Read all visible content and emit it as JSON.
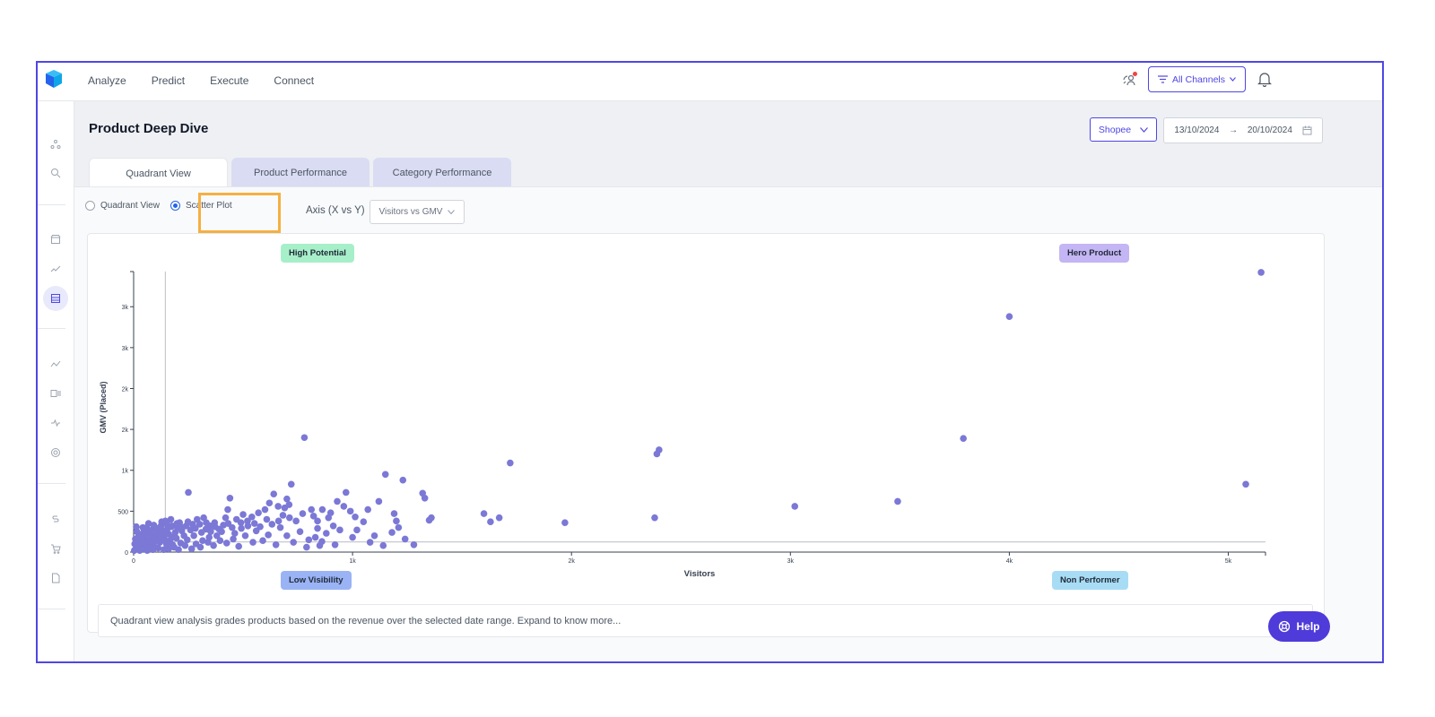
{
  "nav": {
    "items": [
      "Analyze",
      "Predict",
      "Execute",
      "Connect"
    ]
  },
  "topbar": {
    "channels_label": "All Channels"
  },
  "page": {
    "title": "Product Deep Dive",
    "marketplace": "Shopee",
    "date_from": "13/10/2024",
    "date_arrow": "→",
    "date_to": "20/10/2024"
  },
  "tabs": [
    "Quadrant View",
    "Product Performance",
    "Category Performance"
  ],
  "controls": {
    "radio_quadrant": "Quadrant View",
    "radio_scatter": "Scatter Plot",
    "axis_label": "Axis (X vs Y)",
    "axis_value": "Visitors vs GMV"
  },
  "quadrants": {
    "top_left": "High Potential",
    "top_right": "Hero Product",
    "bottom_left": "Low Visibility",
    "bottom_right": "Non Performer"
  },
  "footer": {
    "note": "Quadrant view analysis grades products based on the revenue over the selected date range. Expand to know more..."
  },
  "help": {
    "label": "Help"
  },
  "colors": {
    "accent": "#4f46e5",
    "point": "#7b78d6",
    "high_potential": "#a7efc9",
    "hero_product": "#c4b5f4",
    "low_visibility": "#9ab3f5",
    "non_performer": "#a8dcf5"
  },
  "chart_data": {
    "type": "scatter",
    "xlabel": "Visitors",
    "ylabel": "GMV (Placed)",
    "x_ticks": [
      {
        "v": 0,
        "label": "0"
      },
      {
        "v": 1000,
        "label": "1k"
      },
      {
        "v": 2000,
        "label": "2k"
      },
      {
        "v": 3000,
        "label": "3k"
      },
      {
        "v": 4000,
        "label": "4k"
      },
      {
        "v": 5000,
        "label": "5k"
      }
    ],
    "y_ticks": [
      {
        "v": 0,
        "label": "0"
      },
      {
        "v": 500,
        "label": "500"
      },
      {
        "v": 1000,
        "label": "1k"
      },
      {
        "v": 1500,
        "label": "2k"
      },
      {
        "v": 2000,
        "label": "2k"
      },
      {
        "v": 2500,
        "label": "3k"
      },
      {
        "v": 3000,
        "label": "3k"
      }
    ],
    "xlim": [
      0,
      5170
    ],
    "ylim": [
      0,
      3430
    ],
    "threshold_x": 145,
    "threshold_y": 125,
    "points": [
      [
        5150,
        3420
      ],
      [
        4000,
        2880
      ],
      [
        3790,
        1390
      ],
      [
        5080,
        830
      ],
      [
        3490,
        620
      ],
      [
        3020,
        560
      ],
      [
        2400,
        1250
      ],
      [
        2390,
        1200
      ],
      [
        2380,
        420
      ],
      [
        1720,
        1090
      ],
      [
        1970,
        360
      ],
      [
        1600,
        470
      ],
      [
        1630,
        370
      ],
      [
        1670,
        420
      ],
      [
        780,
        1400
      ],
      [
        1150,
        950
      ],
      [
        1230,
        880
      ],
      [
        1320,
        720
      ],
      [
        1330,
        660
      ],
      [
        1360,
        420
      ],
      [
        1350,
        390
      ],
      [
        1190,
        470
      ],
      [
        1200,
        380
      ],
      [
        1210,
        300
      ],
      [
        1120,
        620
      ],
      [
        1070,
        520
      ],
      [
        1050,
        370
      ],
      [
        970,
        730
      ],
      [
        990,
        500
      ],
      [
        930,
        620
      ],
      [
        960,
        560
      ],
      [
        900,
        480
      ],
      [
        890,
        420
      ],
      [
        840,
        380
      ],
      [
        840,
        290
      ],
      [
        830,
        180
      ],
      [
        850,
        80
      ],
      [
        720,
        830
      ],
      [
        640,
        710
      ],
      [
        700,
        650
      ],
      [
        710,
        580
      ],
      [
        690,
        540
      ],
      [
        660,
        560
      ],
      [
        620,
        600
      ],
      [
        600,
        520
      ],
      [
        570,
        480
      ],
      [
        540,
        430
      ],
      [
        520,
        380
      ],
      [
        500,
        460
      ],
      [
        490,
        360
      ],
      [
        470,
        400
      ],
      [
        440,
        660
      ],
      [
        430,
        520
      ],
      [
        420,
        420
      ],
      [
        450,
        300
      ],
      [
        410,
        330
      ],
      [
        390,
        280
      ],
      [
        370,
        360
      ],
      [
        350,
        320
      ],
      [
        330,
        280
      ],
      [
        320,
        420
      ],
      [
        310,
        240
      ],
      [
        290,
        400
      ],
      [
        270,
        340
      ],
      [
        250,
        730
      ],
      [
        260,
        270
      ],
      [
        240,
        320
      ],
      [
        230,
        200
      ],
      [
        220,
        260
      ],
      [
        210,
        360
      ],
      [
        200,
        300
      ],
      [
        190,
        240
      ],
      [
        180,
        180
      ],
      [
        175,
        320
      ],
      [
        170,
        400
      ],
      [
        165,
        140
      ],
      [
        160,
        220
      ],
      [
        155,
        290
      ],
      [
        150,
        100
      ],
      [
        145,
        380
      ],
      [
        140,
        200
      ],
      [
        135,
        260
      ],
      [
        130,
        160
      ],
      [
        125,
        320
      ],
      [
        120,
        120
      ],
      [
        115,
        240
      ],
      [
        110,
        180
      ],
      [
        105,
        290
      ],
      [
        100,
        140
      ],
      [
        95,
        210
      ],
      [
        90,
        100
      ],
      [
        85,
        270
      ],
      [
        80,
        170
      ],
      [
        75,
        60
      ],
      [
        70,
        230
      ],
      [
        65,
        140
      ],
      [
        60,
        300
      ],
      [
        55,
        90
      ],
      [
        50,
        180
      ],
      [
        45,
        240
      ],
      [
        40,
        120
      ],
      [
        35,
        60
      ],
      [
        30,
        200
      ],
      [
        25,
        140
      ],
      [
        20,
        90
      ],
      [
        15,
        250
      ],
      [
        10,
        40
      ],
      [
        8,
        160
      ],
      [
        5,
        100
      ],
      [
        3,
        20
      ],
      [
        12,
        310
      ],
      [
        28,
        20
      ],
      [
        48,
        40
      ],
      [
        62,
        20
      ],
      [
        88,
        30
      ],
      [
        112,
        50
      ],
      [
        138,
        30
      ],
      [
        160,
        40
      ],
      [
        185,
        60
      ],
      [
        205,
        30
      ],
      [
        235,
        80
      ],
      [
        265,
        40
      ],
      [
        285,
        100
      ],
      [
        305,
        60
      ],
      [
        340,
        120
      ],
      [
        365,
        80
      ],
      [
        395,
        140
      ],
      [
        425,
        110
      ],
      [
        455,
        160
      ],
      [
        480,
        70
      ],
      [
        510,
        200
      ],
      [
        545,
        120
      ],
      [
        560,
        260
      ],
      [
        590,
        140
      ],
      [
        615,
        210
      ],
      [
        650,
        90
      ],
      [
        670,
        300
      ],
      [
        700,
        200
      ],
      [
        730,
        120
      ],
      [
        760,
        250
      ],
      [
        790,
        60
      ],
      [
        800,
        150
      ],
      [
        860,
        130
      ],
      [
        880,
        230
      ],
      [
        920,
        90
      ],
      [
        1000,
        180
      ],
      [
        1020,
        270
      ],
      [
        1080,
        120
      ],
      [
        1100,
        200
      ],
      [
        1140,
        80
      ],
      [
        1180,
        240
      ],
      [
        1240,
        160
      ],
      [
        1280,
        90
      ],
      [
        380,
        200
      ],
      [
        345,
        180
      ],
      [
        315,
        140
      ],
      [
        275,
        200
      ],
      [
        245,
        150
      ],
      [
        215,
        110
      ],
      [
        195,
        170
      ],
      [
        178,
        90
      ],
      [
        158,
        60
      ],
      [
        142,
        150
      ],
      [
        118,
        210
      ],
      [
        98,
        60
      ],
      [
        72,
        130
      ],
      [
        52,
        210
      ],
      [
        38,
        160
      ],
      [
        22,
        190
      ],
      [
        18,
        60
      ],
      [
        42,
        300
      ],
      [
        68,
        350
      ],
      [
        92,
        330
      ],
      [
        128,
        370
      ],
      [
        152,
        340
      ],
      [
        172,
        310
      ],
      [
        198,
        350
      ],
      [
        222,
        300
      ],
      [
        248,
        370
      ],
      [
        282,
        290
      ],
      [
        302,
        340
      ],
      [
        332,
        360
      ],
      [
        352,
        250
      ],
      [
        372,
        310
      ],
      [
        402,
        250
      ],
      [
        432,
        350
      ],
      [
        462,
        230
      ],
      [
        492,
        290
      ],
      [
        522,
        320
      ],
      [
        552,
        350
      ],
      [
        578,
        310
      ],
      [
        608,
        400
      ],
      [
        632,
        340
      ],
      [
        662,
        380
      ],
      [
        682,
        450
      ],
      [
        712,
        420
      ],
      [
        742,
        380
      ],
      [
        772,
        470
      ],
      [
        812,
        520
      ],
      [
        822,
        440
      ],
      [
        862,
        520
      ],
      [
        912,
        320
      ],
      [
        942,
        270
      ],
      [
        1012,
        430
      ]
    ]
  }
}
